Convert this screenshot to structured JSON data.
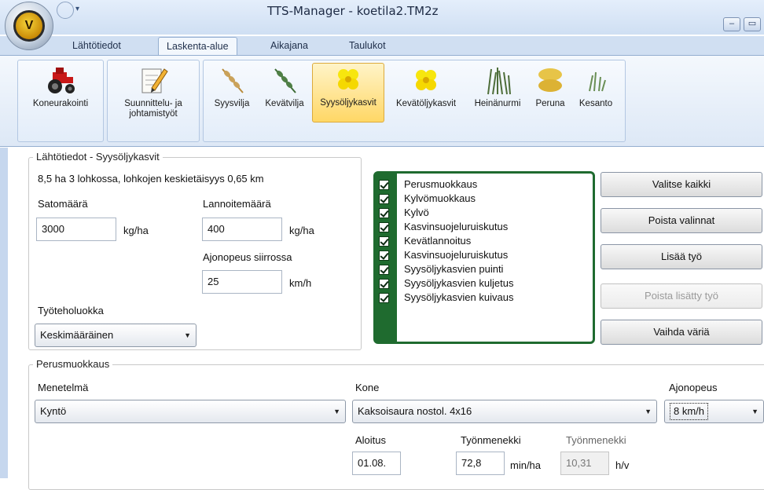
{
  "window": {
    "title": "TTS-Manager - koetila2.TM2z",
    "app_orb_letter": "V",
    "min_symbol": "–",
    "max_symbol": "▭"
  },
  "tabs": [
    {
      "label": "Lähtötiedot"
    },
    {
      "label": "Laskenta-alue",
      "active": true
    },
    {
      "label": "Aikajana"
    },
    {
      "label": "Taulukot"
    }
  ],
  "ribbon": {
    "machinery": {
      "label": "Koneurakointi"
    },
    "planning": {
      "label": "Suunnittelu- ja johtamistyöt"
    },
    "crops": [
      {
        "label": "Syysvilja",
        "icon": "wheat-icon"
      },
      {
        "label": "Kevätvilja",
        "icon": "barley-icon"
      },
      {
        "label": "Syysöljykasvit",
        "icon": "rapeseed-flower-icon",
        "selected": true
      },
      {
        "label": "Kevätöljykasvit",
        "icon": "rapeseed-flower-icon"
      },
      {
        "label": "Heinänurmi",
        "icon": "grass-icon"
      },
      {
        "label": "Peruna",
        "icon": "potato-icon"
      },
      {
        "label": "Kesanto",
        "icon": "fallow-sprout-icon"
      }
    ]
  },
  "basics": {
    "legend": "Lähtötiedot - Syysöljykasvit",
    "summary": "8,5 ha 3 lohkossa, lohkojen keskietäisyys 0,65 km",
    "yield_label": "Satomäärä",
    "yield_value": "3000",
    "yield_unit": "kg/ha",
    "fert_label": "Lannoitemäärä",
    "fert_value": "400",
    "fert_unit": "kg/ha",
    "speed_label": "Ajonopeus siirrossa",
    "speed_value": "25",
    "speed_unit": "km/h",
    "efficiency_label": "Työteholuokka",
    "efficiency_value": "Keskimääräinen"
  },
  "checklist": [
    "Perusmuokkaus",
    "Kylvömuokkaus",
    "Kylvö",
    "Kasvinsuojeluruiskutus",
    "Kevätlannoitus",
    "Kasvinsuojeluruiskutus",
    "Syysöljykasvien puinti",
    "Syysöljykasvien kuljetus",
    "Syysöljykasvien kuivaus"
  ],
  "buttons": {
    "select_all": "Valitse kaikki",
    "clear": "Poista valinnat",
    "add_work": "Lisää työ",
    "remove_added": "Poista lisätty työ",
    "change_color": "Vaihda väriä"
  },
  "tillage": {
    "legend": "Perusmuokkaus",
    "method_label": "Menetelmä",
    "method_value": "Kyntö",
    "machine_label": "Kone",
    "machine_value": "Kaksoisaura nostol. 4x16",
    "speed_label": "Ajonopeus",
    "speed_value": "8 km/h",
    "start_label": "Aloitus",
    "start_value": "01.08.",
    "work1_label": "Työnmenekki",
    "work1_value": "72,8",
    "work1_unit": "min/ha",
    "work2_label": "Työnmenekki",
    "work2_value": "10,31",
    "work2_unit": "h/v"
  },
  "colors": {
    "checklist_green": "#1f6b2f",
    "ribbon_blue": "#dde8f6",
    "highlight_yellow": "#ffd766"
  }
}
